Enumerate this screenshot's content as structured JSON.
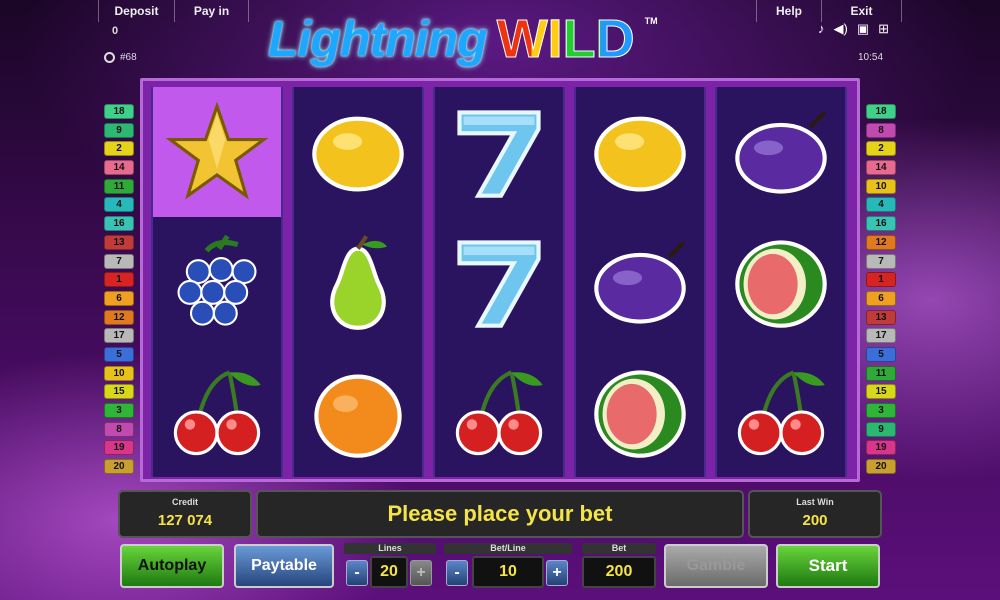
{
  "topbar": {
    "deposit": "Deposit",
    "payin": "Pay in",
    "help": "Help",
    "exit": "Exit"
  },
  "deposit_amount": "0",
  "round_number": "#68",
  "clock": "10:54",
  "status_icons": [
    "music-note-icon",
    "speaker-icon",
    "fullscreen-icon",
    "settings-icon"
  ],
  "logo": {
    "part1": "Lightning",
    "part2": "WILD",
    "tm": "TM"
  },
  "reels": [
    [
      "star",
      "grapes",
      "cherries"
    ],
    [
      "lemon",
      "pear",
      "orange"
    ],
    [
      "seven",
      "seven",
      "cherries"
    ],
    [
      "lemon",
      "plum",
      "watermelon"
    ],
    [
      "plum",
      "watermelon",
      "cherries"
    ]
  ],
  "highlighted_symbol": "star",
  "lines_left": [
    {
      "n": "18",
      "c": "#3fd08a"
    },
    {
      "n": "9",
      "c": "#2cb873"
    },
    {
      "n": "2",
      "c": "#e5d21a"
    },
    {
      "n": "14",
      "c": "#e86b8f"
    },
    {
      "n": "11",
      "c": "#2faa3a"
    },
    {
      "n": "4",
      "c": "#27b9b9"
    },
    {
      "n": "16",
      "c": "#38c3b5"
    },
    {
      "n": "13",
      "c": "#c23b3b"
    },
    {
      "n": "7",
      "c": "#b9b9b9"
    },
    {
      "n": "1",
      "c": "#d62424"
    },
    {
      "n": "6",
      "c": "#f0a020"
    },
    {
      "n": "12",
      "c": "#e07a20"
    },
    {
      "n": "17",
      "c": "#b8b8b8"
    },
    {
      "n": "5",
      "c": "#3b6ed8"
    },
    {
      "n": "10",
      "c": "#e8c21a"
    },
    {
      "n": "15",
      "c": "#d8d81a"
    },
    {
      "n": "3",
      "c": "#2fb63a"
    },
    {
      "n": "8",
      "c": "#c04ab0"
    },
    {
      "n": "19",
      "c": "#d8368b"
    },
    {
      "n": "20",
      "c": "#c9a030"
    }
  ],
  "lines_right": [
    {
      "n": "18",
      "c": "#3fd08a"
    },
    {
      "n": "8",
      "c": "#c04ab0"
    },
    {
      "n": "2",
      "c": "#e5d21a"
    },
    {
      "n": "14",
      "c": "#e86b8f"
    },
    {
      "n": "10",
      "c": "#e8c21a"
    },
    {
      "n": "4",
      "c": "#27b9b9"
    },
    {
      "n": "16",
      "c": "#38c3b5"
    },
    {
      "n": "12",
      "c": "#e07a20"
    },
    {
      "n": "7",
      "c": "#b9b9b9"
    },
    {
      "n": "1",
      "c": "#d62424"
    },
    {
      "n": "6",
      "c": "#f0a020"
    },
    {
      "n": "13",
      "c": "#c23b3b"
    },
    {
      "n": "17",
      "c": "#b8b8b8"
    },
    {
      "n": "5",
      "c": "#3b6ed8"
    },
    {
      "n": "11",
      "c": "#2faa3a"
    },
    {
      "n": "15",
      "c": "#d8d81a"
    },
    {
      "n": "3",
      "c": "#2fb63a"
    },
    {
      "n": "9",
      "c": "#2cb873"
    },
    {
      "n": "19",
      "c": "#d8368b"
    },
    {
      "n": "20",
      "c": "#c9a030"
    }
  ],
  "credit": {
    "label": "Credit",
    "value": "127 074"
  },
  "message": "Please place your bet",
  "last_win": {
    "label": "Last Win",
    "value": "200"
  },
  "buttons": {
    "autoplay": "Autoplay",
    "paytable": "Paytable",
    "gamble": "Gamble",
    "start": "Start"
  },
  "lines": {
    "label": "Lines",
    "value": "20"
  },
  "bet_line": {
    "label": "Bet/Line",
    "value": "10"
  },
  "bet": {
    "label": "Bet",
    "value": "200"
  },
  "minus": "-",
  "plus": "+"
}
